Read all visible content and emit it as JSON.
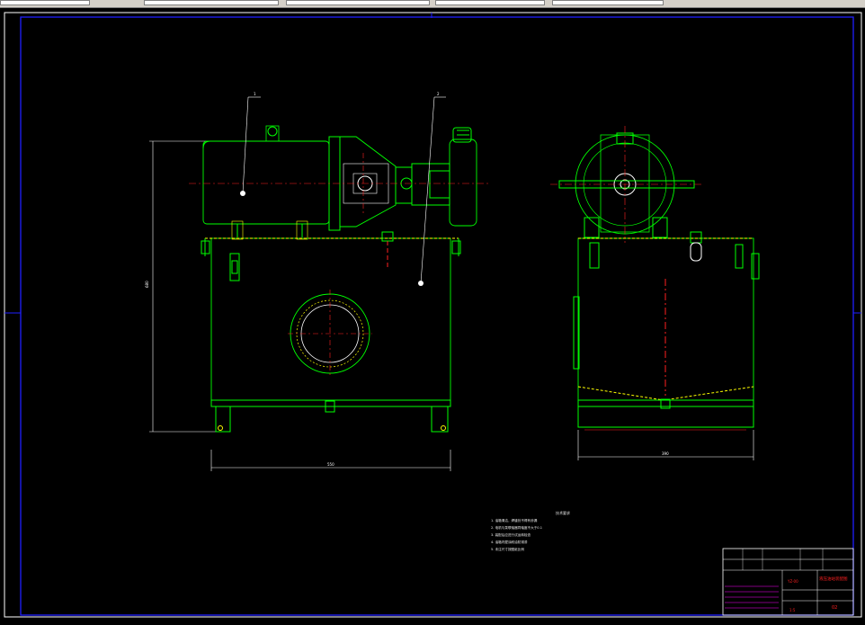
{
  "toolbar": {
    "fields": [
      "",
      "",
      "",
      "",
      "",
      ""
    ]
  },
  "drawing": {
    "front_view": {
      "callout_1": "1",
      "callout_2": "2",
      "dim_width": "550",
      "dim_height": "680"
    },
    "side_view": {
      "dim_width": "390"
    },
    "notes": {
      "title": "技术要求",
      "lines": [
        "1. 油箱清洁，焊缝处不得有渗漏",
        "2. 电机与泵联轴器同轴度不大于0.1",
        "3. 装配后应进行试运转检查",
        "4. 油箱内壁涂耐油防锈漆",
        "5. 未注尺寸按图纸比例"
      ]
    },
    "title_block": {
      "title": "液压油站装配图",
      "drawing_no": "YZ-00",
      "sheet": "02",
      "scale": "1:5"
    }
  },
  "colors": {
    "background": "#000000",
    "frame": "#2020ff",
    "outline": "#00ff00",
    "yellow": "#ffff00",
    "red": "#ff2020",
    "white": "#ffffff",
    "magenta": "#ff00ff"
  }
}
